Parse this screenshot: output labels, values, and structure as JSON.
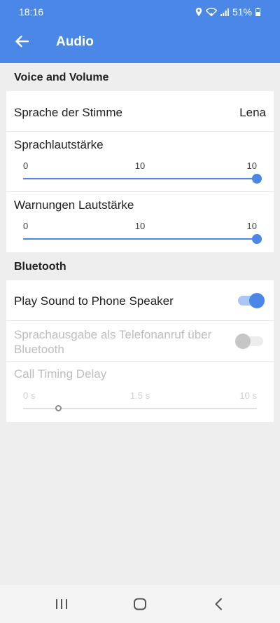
{
  "status_bar": {
    "time": "18:16",
    "battery": "51%"
  },
  "app_bar": {
    "title": "Audio"
  },
  "sections": {
    "voice": {
      "header": "Voice and Volume",
      "voice_language": {
        "label": "Sprache der Stimme",
        "value": "Lena"
      },
      "voice_volume": {
        "label": "Sprachlautstärke",
        "min": "0",
        "mid": "10",
        "max": "10",
        "value_fraction": 1.0
      },
      "warning_volume": {
        "label": "Warnungen Lautstärke",
        "min": "0",
        "mid": "10",
        "max": "10",
        "value_fraction": 1.0
      }
    },
    "bluetooth": {
      "header": "Bluetooth",
      "play_sound": {
        "label": "Play Sound to Phone Speaker",
        "enabled": true
      },
      "bt_call": {
        "label": "Sprachausgabe als Telefonanruf über Bluetooth",
        "enabled": false
      },
      "call_delay": {
        "label": "Call Timing Delay",
        "min": "0 s",
        "mid": "1.5 s",
        "max": "10 s",
        "value_fraction": 0.15
      }
    }
  },
  "nav_bar": {
    "icons": [
      "recent-apps-icon",
      "home-icon",
      "back-icon"
    ]
  },
  "colors": {
    "accent": "#4a87e6",
    "background": "#eeeeee",
    "disabled_text": "#bdbdbd"
  }
}
